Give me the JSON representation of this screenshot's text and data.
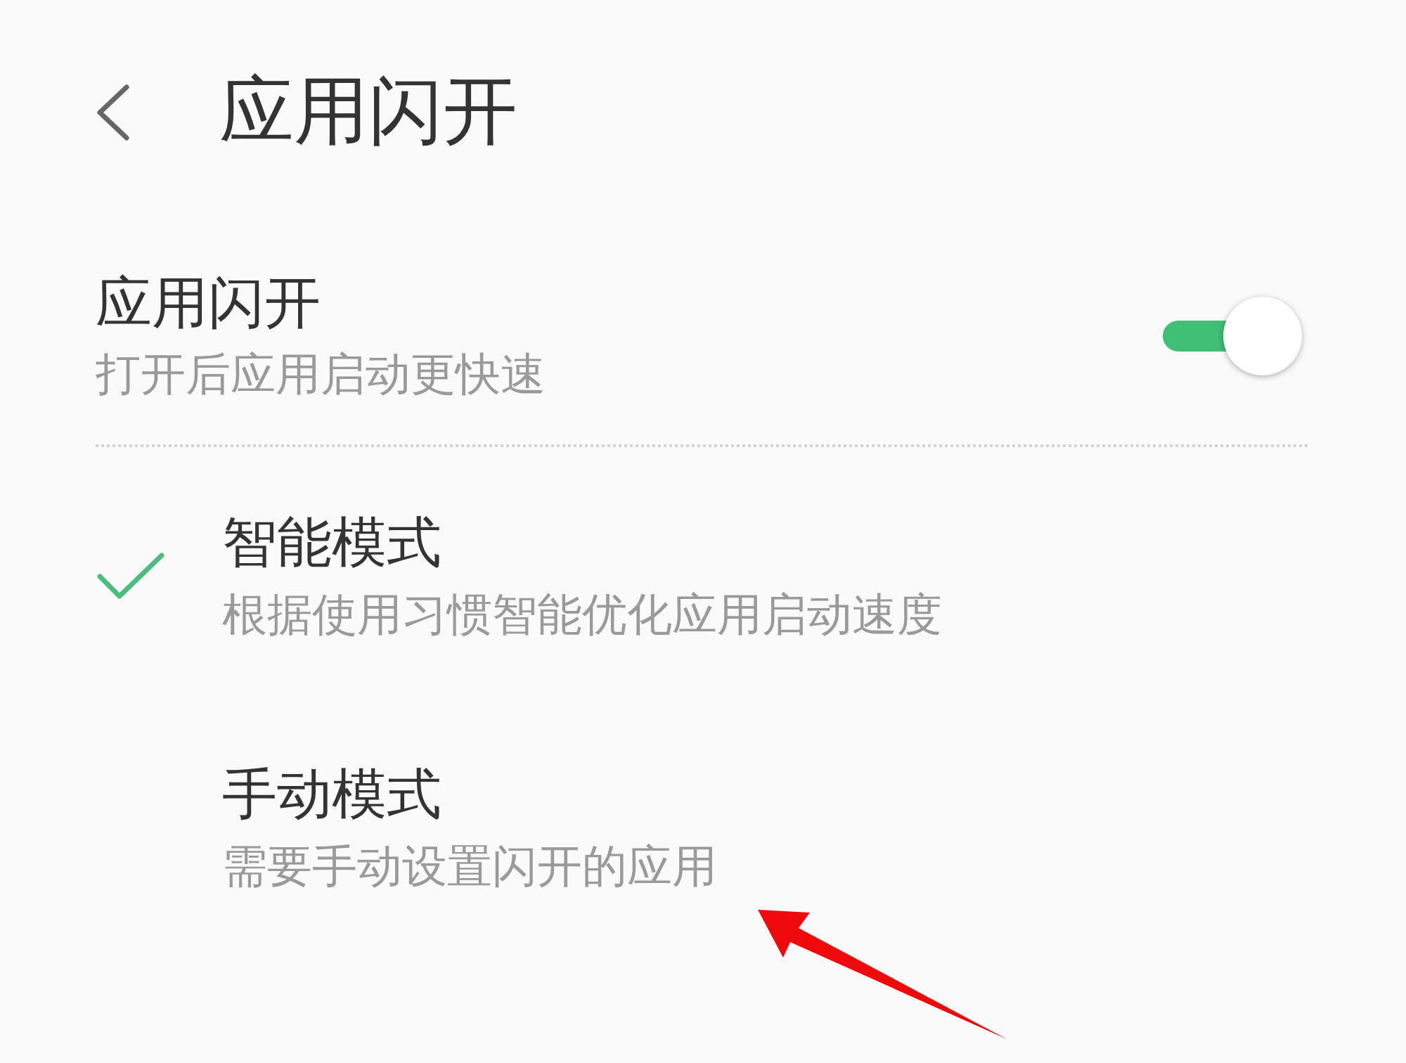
{
  "header": {
    "title": "应用闪开"
  },
  "switch_row": {
    "title": "应用闪开",
    "subtitle": "打开后应用启动更快速",
    "on": true
  },
  "modes": [
    {
      "title": "智能模式",
      "subtitle": "根据使用习惯智能优化应用启动速度",
      "selected": true
    },
    {
      "title": "手动模式",
      "subtitle": "需要手动设置闪开的应用",
      "selected": false
    }
  ]
}
